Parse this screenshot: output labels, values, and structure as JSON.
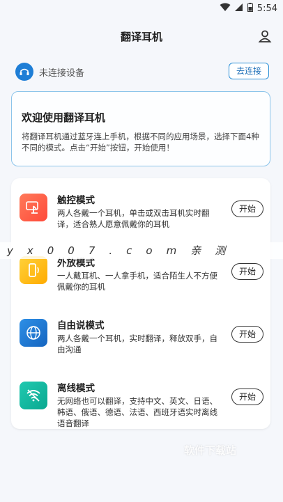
{
  "status_bar": {
    "time": "5:54"
  },
  "header": {
    "title": "翻译耳机"
  },
  "device": {
    "status_text": "未连接设备",
    "connect_label": "去连接"
  },
  "welcome": {
    "title": "欢迎使用翻译耳机",
    "description": "将翻译耳机通过蓝牙连上手机，根据不同的应用场景，选择下面4种不同的模式。点击“开始”按钮，开始使用！"
  },
  "modes": [
    {
      "title": "触控模式",
      "desc": "两人各戴一个耳机，单击或双击耳机实时翻译，适合熟人愿意佩戴你的耳机",
      "start": "开始",
      "color": "#ff5a45"
    },
    {
      "title": "外放模式",
      "desc": "一人戴耳机、一人拿手机，适合陌生人不方便佩戴你的耳机",
      "start": "开始",
      "color": "#ffb300"
    },
    {
      "title": "自由说模式",
      "desc": "两人各戴一个耳机，实时翻译，释放双手，自由沟通",
      "start": "开始",
      "color": "#1e7ed6"
    },
    {
      "title": "离线模式",
      "desc": "无网络也可以翻译，支持中文、英文、日语、韩语、俄语、德语、法语、西班牙语实时离线语音翻译",
      "start": "开始",
      "color": "#12b8a4"
    }
  ],
  "watermark": {
    "text": "yx007.com亲测",
    "footer": "软件下载站"
  }
}
